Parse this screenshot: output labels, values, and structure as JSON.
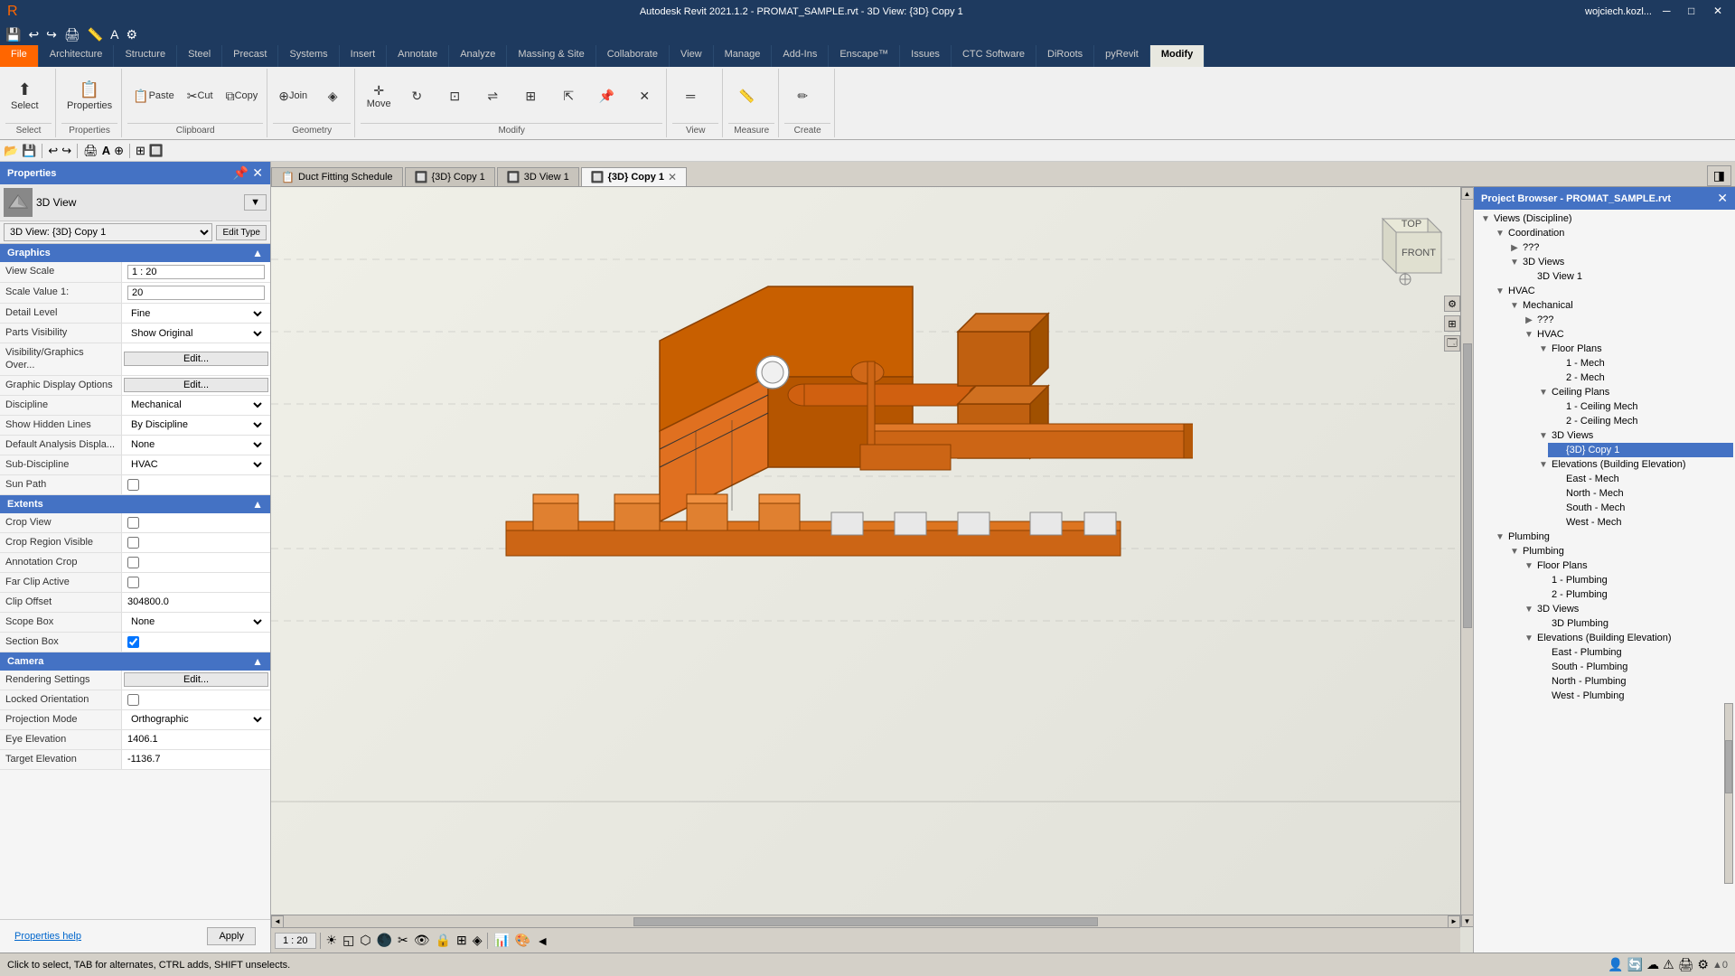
{
  "titlebar": {
    "title": "Autodesk Revit 2021.1.2 - PROMAT_SAMPLE.rvt - 3D View: {3D} Copy 1",
    "user": "wojciech.kozl..."
  },
  "ribbon": {
    "tabs": [
      "File",
      "Architecture",
      "Structure",
      "Steel",
      "Precast",
      "Systems",
      "Insert",
      "Annotate",
      "Analyze",
      "Massing & Site",
      "Collaborate",
      "View",
      "Manage",
      "Add-Ins",
      "Enscape™",
      "Issues",
      "CTC Software",
      "DiRoots",
      "pyRevit",
      "Modify"
    ],
    "active_tab": "Modify",
    "groups": [
      {
        "label": "Select",
        "items": [
          "Select"
        ]
      },
      {
        "label": "Properties",
        "items": [
          "Properties"
        ]
      },
      {
        "label": "Clipboard",
        "items": [
          "Paste",
          "Cut",
          "Copy"
        ]
      },
      {
        "label": "Geometry",
        "items": [
          "Join",
          "Geometry"
        ]
      },
      {
        "label": "Modify",
        "items": [
          "Move",
          "Rotate",
          "Mirror"
        ]
      },
      {
        "label": "View",
        "items": [
          "View"
        ]
      },
      {
        "label": "Measure",
        "items": [
          "Measure"
        ]
      },
      {
        "label": "Create",
        "items": [
          "Create"
        ]
      }
    ]
  },
  "view_tabs": [
    {
      "id": "duct-schedule",
      "label": "Duct Fitting Schedule",
      "icon": "📋",
      "closeable": false,
      "active": false
    },
    {
      "id": "3d-copy1",
      "label": "{3D} Copy 1",
      "icon": "🔲",
      "closeable": false,
      "active": false
    },
    {
      "id": "3d-view1",
      "label": "3D View 1",
      "icon": "🔲",
      "closeable": false,
      "active": false
    },
    {
      "id": "3d-copy1-active",
      "label": "{3D} Copy 1",
      "icon": "🔲",
      "closeable": true,
      "active": true
    }
  ],
  "properties": {
    "header": "Properties",
    "type": "3D View",
    "view_name": "3D View: {3D} Copy 1",
    "edit_type_label": "Edit Type",
    "sections": [
      {
        "id": "graphics",
        "label": "Graphics",
        "rows": [
          {
            "label": "View Scale",
            "value": "1 : 20",
            "type": "input"
          },
          {
            "label": "Scale Value  1:",
            "value": "20",
            "type": "input"
          },
          {
            "label": "Detail Level",
            "value": "Fine",
            "type": "select"
          },
          {
            "label": "Parts Visibility",
            "value": "Show Original",
            "type": "select"
          },
          {
            "label": "Visibility/Graphics Over...",
            "value": "Edit...",
            "type": "button"
          },
          {
            "label": "Graphic Display Options",
            "value": "Edit...",
            "type": "button"
          },
          {
            "label": "Discipline",
            "value": "Mechanical",
            "type": "select"
          },
          {
            "label": "Show Hidden Lines",
            "value": "By Discipline",
            "type": "select"
          },
          {
            "label": "Default Analysis Displa...",
            "value": "None",
            "type": "select"
          },
          {
            "label": "Sub-Discipline",
            "value": "HVAC",
            "type": "select"
          },
          {
            "label": "Sun Path",
            "value": false,
            "type": "checkbox"
          }
        ]
      },
      {
        "id": "extents",
        "label": "Extents",
        "rows": [
          {
            "label": "Crop View",
            "value": false,
            "type": "checkbox"
          },
          {
            "label": "Crop Region Visible",
            "value": false,
            "type": "checkbox"
          },
          {
            "label": "Annotation Crop",
            "value": false,
            "type": "checkbox"
          },
          {
            "label": "Far Clip Active",
            "value": false,
            "type": "checkbox"
          },
          {
            "label": "Clip Offset",
            "value": "304800.0",
            "type": "text"
          },
          {
            "label": "Scope Box",
            "value": "None",
            "type": "select"
          },
          {
            "label": "Section Box",
            "value": true,
            "type": "checkbox"
          }
        ]
      },
      {
        "id": "camera",
        "label": "Camera",
        "rows": [
          {
            "label": "Rendering Settings",
            "value": "Edit...",
            "type": "button"
          },
          {
            "label": "Locked Orientation",
            "value": false,
            "type": "checkbox"
          },
          {
            "label": "Projection Mode",
            "value": "Orthographic",
            "type": "select"
          },
          {
            "label": "Eye Elevation",
            "value": "1406.1",
            "type": "text"
          },
          {
            "label": "Target Elevation",
            "value": "-1136.7",
            "type": "text"
          }
        ]
      }
    ],
    "help_link": "Properties help",
    "apply_label": "Apply"
  },
  "project_browser": {
    "header": "Project Browser - PROMAT_SAMPLE.rvt",
    "tree": [
      {
        "label": "Views (Discipline)",
        "expanded": true,
        "children": [
          {
            "label": "Coordination",
            "expanded": true,
            "children": [
              {
                "label": "???",
                "children": []
              },
              {
                "label": "3D Views",
                "expanded": true,
                "children": [
                  {
                    "label": "3D View 1",
                    "children": [],
                    "selected": false
                  }
                ]
              }
            ]
          },
          {
            "label": "HVAC",
            "expanded": true,
            "children": [
              {
                "label": "Mechanical",
                "expanded": true,
                "children": [
                  {
                    "label": "???",
                    "children": []
                  },
                  {
                    "label": "HVAC",
                    "expanded": true,
                    "children": [
                      {
                        "label": "Floor Plans",
                        "expanded": true,
                        "children": [
                          {
                            "label": "1 - Mech",
                            "children": []
                          },
                          {
                            "label": "2 - Mech",
                            "children": []
                          }
                        ]
                      },
                      {
                        "label": "Ceiling Plans",
                        "expanded": true,
                        "children": [
                          {
                            "label": "1 - Ceiling Mech",
                            "children": []
                          },
                          {
                            "label": "2 - Ceiling Mech",
                            "children": []
                          }
                        ]
                      },
                      {
                        "label": "3D Views",
                        "expanded": true,
                        "children": [
                          {
                            "label": "{3D} Copy 1",
                            "children": [],
                            "selected": true
                          }
                        ]
                      },
                      {
                        "label": "Elevations (Building Elevation)",
                        "expanded": true,
                        "children": [
                          {
                            "label": "East - Mech",
                            "children": []
                          },
                          {
                            "label": "North - Mech",
                            "children": []
                          },
                          {
                            "label": "South - Mech",
                            "children": []
                          },
                          {
                            "label": "West - Mech",
                            "children": []
                          }
                        ]
                      }
                    ]
                  }
                ]
              }
            ]
          },
          {
            "label": "Plumbing",
            "expanded": true,
            "children": [
              {
                "label": "Plumbing",
                "expanded": true,
                "children": [
                  {
                    "label": "Floor Plans",
                    "expanded": true,
                    "children": [
                      {
                        "label": "1 - Plumbing",
                        "children": []
                      },
                      {
                        "label": "2 - Plumbing",
                        "children": []
                      }
                    ]
                  },
                  {
                    "label": "3D Views",
                    "expanded": true,
                    "children": [
                      {
                        "label": "3D Plumbing",
                        "children": []
                      }
                    ]
                  },
                  {
                    "label": "Elevations (Building Elevation)",
                    "expanded": true,
                    "children": [
                      {
                        "label": "East - Plumbing",
                        "children": []
                      },
                      {
                        "label": "South - Plumbing",
                        "children": []
                      },
                      {
                        "label": "North - Plumbing",
                        "children": []
                      },
                      {
                        "label": "West - Plumbing",
                        "children": []
                      }
                    ]
                  }
                ]
              }
            ]
          }
        ]
      }
    ]
  },
  "statusbar": {
    "message": "Click to select, TAB for alternates, CTRL adds, SHIFT unselects.",
    "scale": "1 : 20"
  },
  "nav_toolbar": {
    "buttons": [
      "⬅",
      "➡",
      "🔍",
      "⊞",
      "↩",
      "↻",
      "🏠",
      "🔄"
    ]
  }
}
